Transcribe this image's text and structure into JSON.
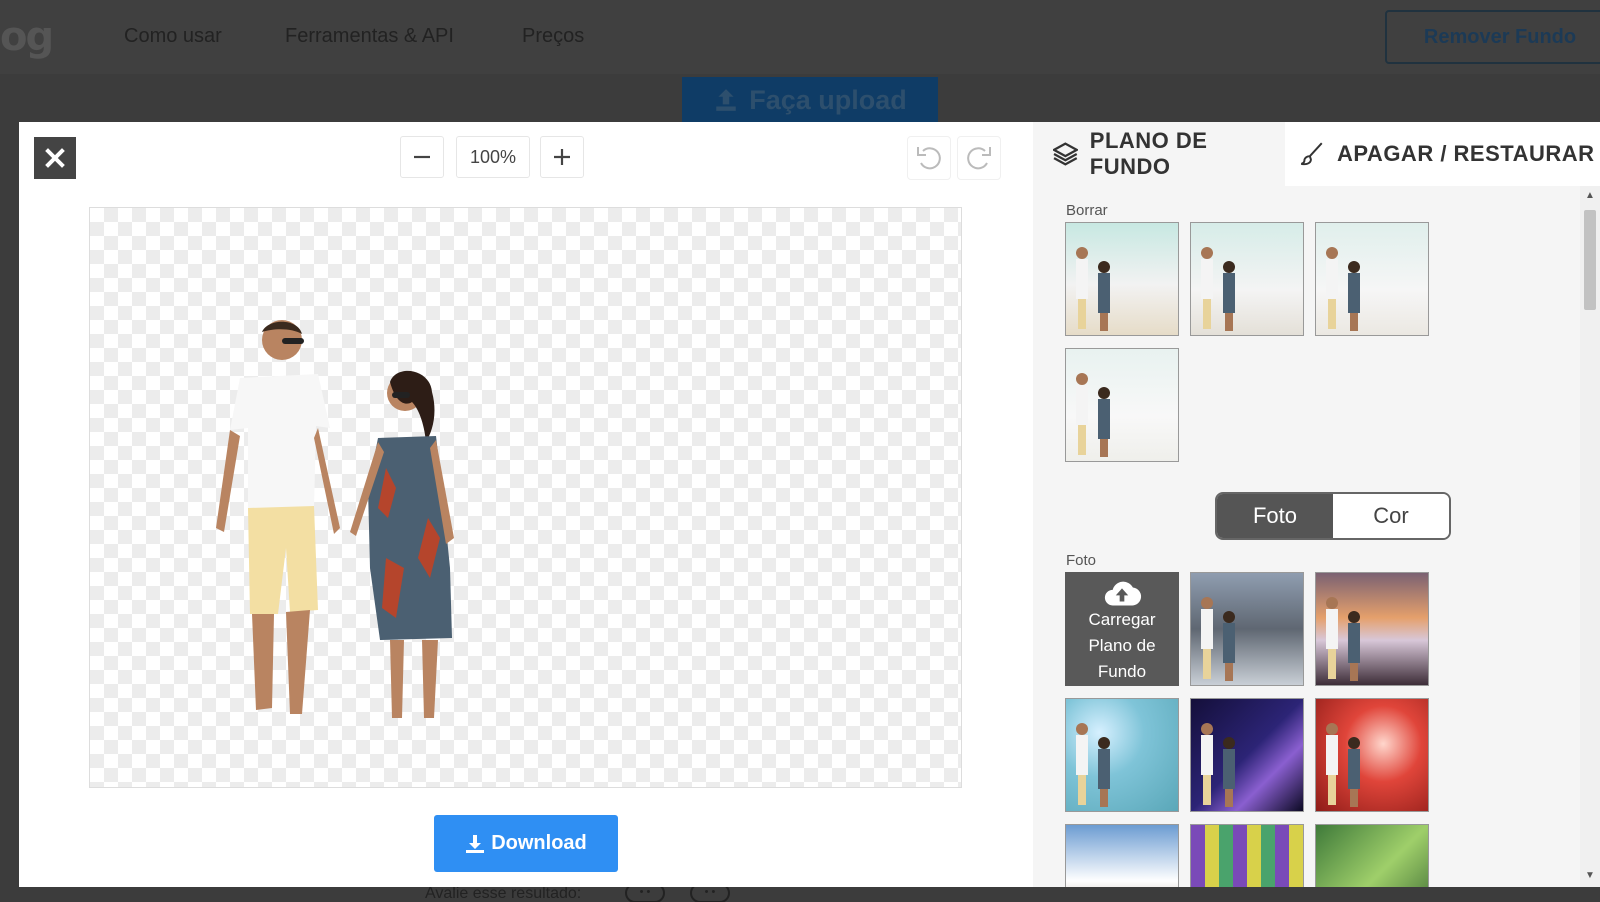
{
  "site": {
    "logo_fragment": "og",
    "nav": [
      "Como usar",
      "Ferramentas & API",
      "Preços"
    ],
    "remove_bg_label": "Remover Fundo",
    "upload_label": "Faça upload",
    "rate_label": "Avalie esse resultado:"
  },
  "editor": {
    "zoom": "100%",
    "download_label": "Download"
  },
  "panel": {
    "tabs": [
      {
        "label": "PLANO DE FUNDO",
        "icon": "layers-icon"
      },
      {
        "label": "APAGAR / RESTAURAR",
        "icon": "brush-icon"
      }
    ],
    "blur_label": "Borrar",
    "toggle": {
      "photo": "Foto",
      "color": "Cor",
      "selected": "Foto"
    },
    "photo_label": "Foto",
    "upload_tile": [
      "Carregar",
      "Plano de",
      "Fundo"
    ]
  }
}
